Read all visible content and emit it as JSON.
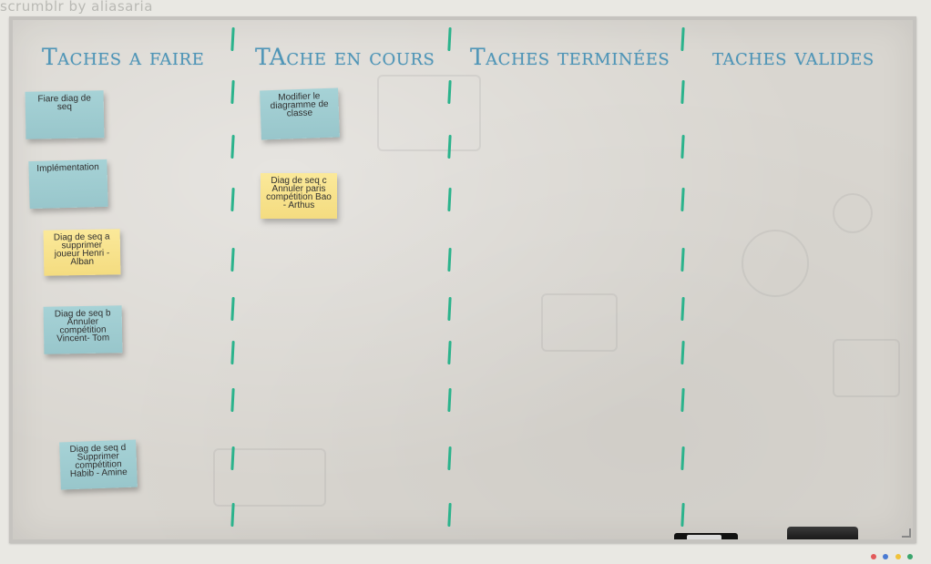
{
  "app": {
    "brand": "scrumblr by aliasaria"
  },
  "columns": [
    {
      "title": "Taches a faire"
    },
    {
      "title": "TAche en cours"
    },
    {
      "title": "Taches terminées"
    },
    {
      "title": "taches valides"
    }
  ],
  "cards": [
    {
      "text": "Fiare diag de seq",
      "color": "blue"
    },
    {
      "text": "Implémentation",
      "color": "blue"
    },
    {
      "text": "Diag de seq a supprimer joueur Henri - Alban",
      "color": "yellow"
    },
    {
      "text": "Diag de seq b Annuler compétition Vincent- Tom",
      "color": "blue"
    },
    {
      "text": "Diag de seq d Supprimer compétition Habib - Amine",
      "color": "blue"
    },
    {
      "text": "Modifier le diagramme de classe",
      "color": "blue"
    },
    {
      "text": "Diag de seq c Annuler paris compétition Bao - Arthus",
      "color": "yellow"
    }
  ],
  "colors": {
    "title_blue": "#4f95b7",
    "divider_green": "#2bb38c",
    "note_blue": "#a6d2d6",
    "note_yellow": "#fbe99a"
  },
  "icons": [
    "marker-icon",
    "eraser-icon",
    "resize-grip-icon"
  ]
}
